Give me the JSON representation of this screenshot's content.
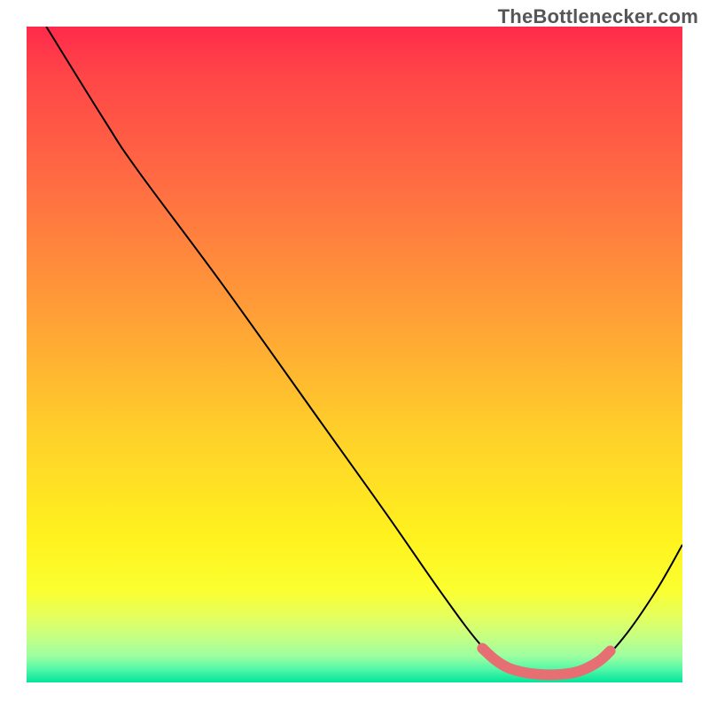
{
  "attribution": "TheBottlenecker.com",
  "chart_data": {
    "type": "line",
    "title": "",
    "xlabel": "",
    "ylabel": "",
    "xlim": [
      0,
      100
    ],
    "ylim": [
      0,
      100
    ],
    "series": [
      {
        "name": "curve",
        "color": "#000000",
        "points": [
          {
            "x": 3.0,
            "y": 100.0
          },
          {
            "x": 12.0,
            "y": 85.5
          },
          {
            "x": 17.0,
            "y": 78.0
          },
          {
            "x": 30.0,
            "y": 60.5
          },
          {
            "x": 45.0,
            "y": 39.5
          },
          {
            "x": 55.0,
            "y": 25.5
          },
          {
            "x": 63.0,
            "y": 14.0
          },
          {
            "x": 69.0,
            "y": 6.0
          },
          {
            "x": 73.0,
            "y": 2.4
          },
          {
            "x": 78.0,
            "y": 1.2
          },
          {
            "x": 83.0,
            "y": 1.2
          },
          {
            "x": 87.0,
            "y": 2.8
          },
          {
            "x": 91.0,
            "y": 6.8
          },
          {
            "x": 96.0,
            "y": 14.0
          },
          {
            "x": 100.0,
            "y": 21.0
          }
        ]
      },
      {
        "name": "optimal-zone",
        "color": "#e56f72",
        "points": [
          {
            "x": 69.5,
            "y": 5.2
          },
          {
            "x": 71.5,
            "y": 3.4
          },
          {
            "x": 73.5,
            "y": 2.2
          },
          {
            "x": 76.0,
            "y": 1.5
          },
          {
            "x": 78.5,
            "y": 1.2
          },
          {
            "x": 81.0,
            "y": 1.2
          },
          {
            "x": 83.5,
            "y": 1.5
          },
          {
            "x": 85.5,
            "y": 2.2
          },
          {
            "x": 87.5,
            "y": 3.4
          },
          {
            "x": 89.0,
            "y": 4.8
          }
        ]
      }
    ],
    "gradient_colors": {
      "top": "#ff2a4b",
      "mid": "#ffd02a",
      "bottom": "#00e59a"
    }
  }
}
